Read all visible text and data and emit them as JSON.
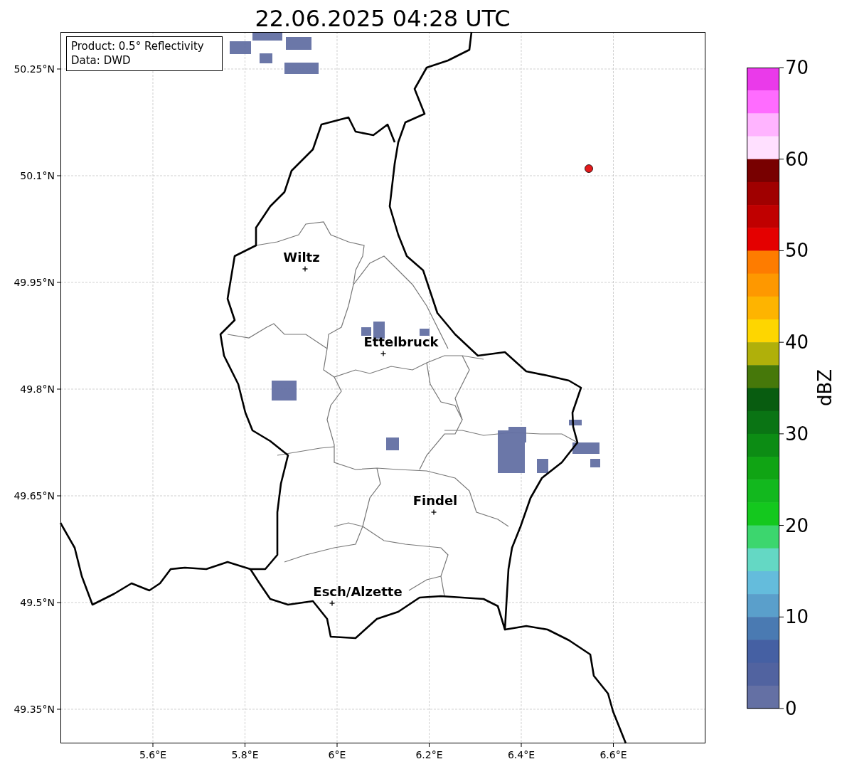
{
  "title": "22.06.2025 04:28 UTC",
  "info_box": {
    "lines": [
      "Product: 0.5° Reflectivity",
      "Data: DWD"
    ]
  },
  "map": {
    "lon_ticks": [
      "5.6°E",
      "5.8°E",
      "6°E",
      "6.2°E",
      "6.4°E",
      "6.6°E"
    ],
    "lat_ticks": [
      "50.25°N",
      "50.1°N",
      "49.95°N",
      "49.8°N",
      "49.65°N",
      "49.5°N",
      "49.35°N"
    ],
    "cities": [
      {
        "name": "Wiltz"
      },
      {
        "name": "Ettelbruck"
      },
      {
        "name": "Findel"
      },
      {
        "name": "Esch/Alzette"
      }
    ],
    "radar_site": {
      "color": "#e41a1c"
    }
  },
  "colorbar": {
    "label": "dBZ",
    "ticks": [
      "70",
      "60",
      "50",
      "40",
      "30",
      "20",
      "10",
      "0"
    ],
    "segments": [
      {
        "color": "#ea3aea"
      },
      {
        "color": "#ff6cff"
      },
      {
        "color": "#ffb4ff"
      },
      {
        "color": "#ffe0ff"
      },
      {
        "color": "#780000"
      },
      {
        "color": "#a00000"
      },
      {
        "color": "#c00000"
      },
      {
        "color": "#e40000"
      },
      {
        "color": "#fe7c00"
      },
      {
        "color": "#fe9800"
      },
      {
        "color": "#feb400"
      },
      {
        "color": "#fed600"
      },
      {
        "color": "#b0b00a"
      },
      {
        "color": "#46780a"
      },
      {
        "color": "#085c10"
      },
      {
        "color": "#0a7414"
      },
      {
        "color": "#0c8c14"
      },
      {
        "color": "#10a414"
      },
      {
        "color": "#12b81e"
      },
      {
        "color": "#14c81e"
      },
      {
        "color": "#3cd66e"
      },
      {
        "color": "#64d8c4"
      },
      {
        "color": "#64bcdc"
      },
      {
        "color": "#5a9fcb"
      },
      {
        "color": "#4a7ab2"
      },
      {
        "color": "#4560a3"
      },
      {
        "color": "#5163a0"
      },
      {
        "color": "#6470a4"
      }
    ]
  }
}
